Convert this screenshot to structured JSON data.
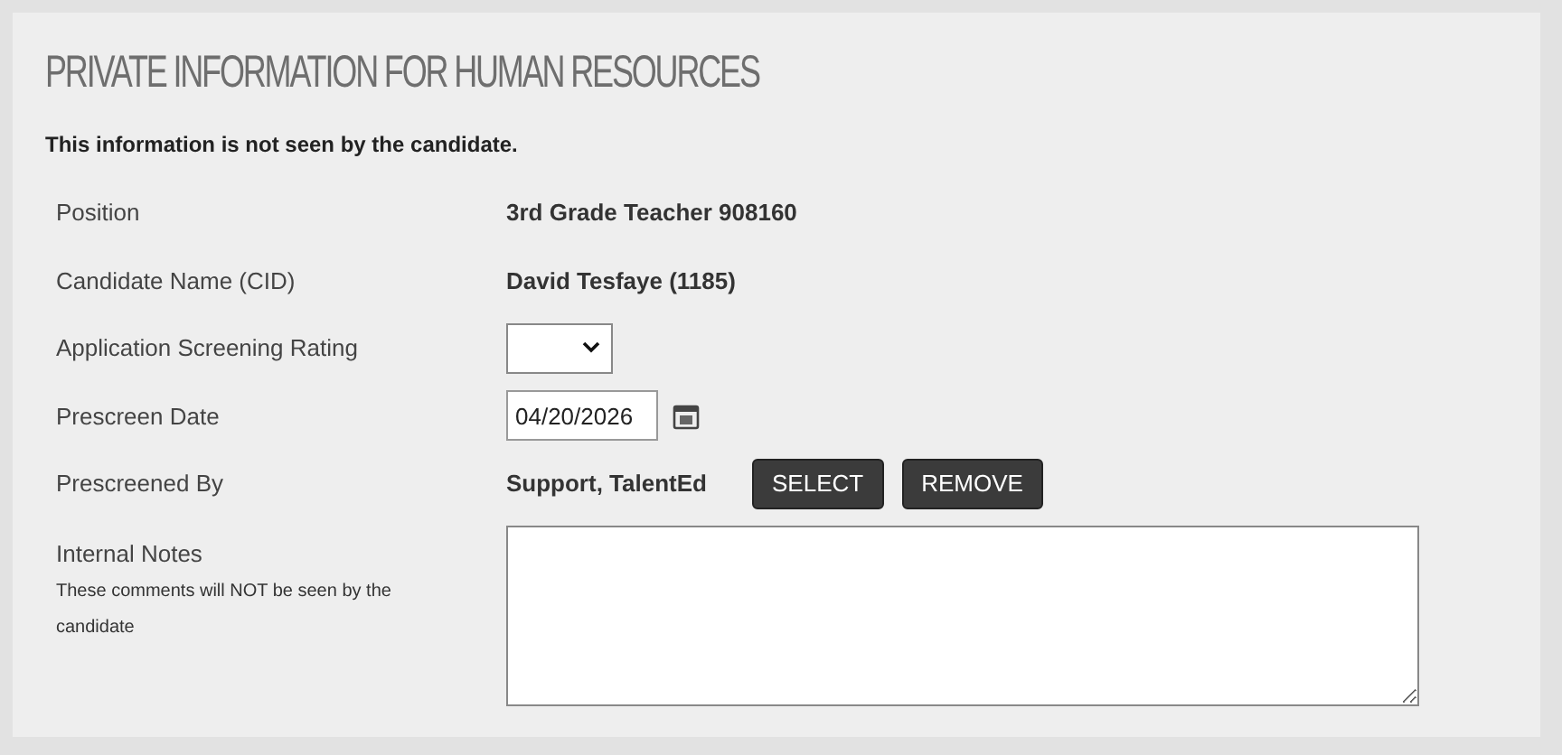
{
  "title": "PRIVATE INFORMATION FOR HUMAN RESOURCES",
  "notice": "This information is not seen by the candidate.",
  "fields": [
    {
      "kind": "text",
      "label": "Position",
      "value": "3rd Grade Teacher 908160"
    },
    {
      "kind": "text",
      "label": "Candidate Name (CID)",
      "value": "David Tesfaye (1185)"
    },
    {
      "kind": "select",
      "label": "Application Screening Rating"
    },
    {
      "kind": "date",
      "label": "Prescreen Date",
      "value": "04/20/2026"
    },
    {
      "kind": "person",
      "label": "Prescreened By",
      "value": "Support, TalentEd",
      "buttons": [
        "SELECT",
        "REMOVE"
      ]
    },
    {
      "kind": "notes",
      "label": "Internal Notes",
      "hint": "These comments will NOT be seen by the candidate"
    }
  ]
}
